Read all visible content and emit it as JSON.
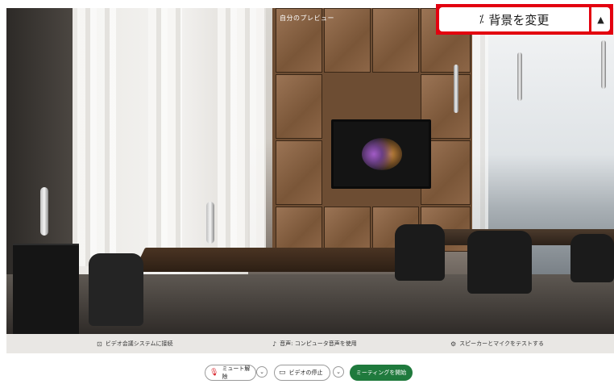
{
  "preview": {
    "title": "自分のプレビュー"
  },
  "background_control": {
    "change_label": "背景を変更",
    "wand_icon": "magic-wand-icon",
    "toggle_icon": "tent-icon"
  },
  "info_bar": {
    "items": [
      {
        "icon": "video-system-icon",
        "label": "ビデオ会議システムに接続"
      },
      {
        "icon": "audio-icon",
        "label": "音声: コンピュータ音声を使用"
      },
      {
        "icon": "gear-icon",
        "label": "スピーカーとマイクをテストする"
      }
    ]
  },
  "controls": {
    "unmute_label": "ミュート解除",
    "stop_video_label": "ビデオの停止",
    "start_meeting_label": "ミーティングを開始",
    "accent_color": "#1f7a3d",
    "mute_icon_color": "#d8232a"
  }
}
